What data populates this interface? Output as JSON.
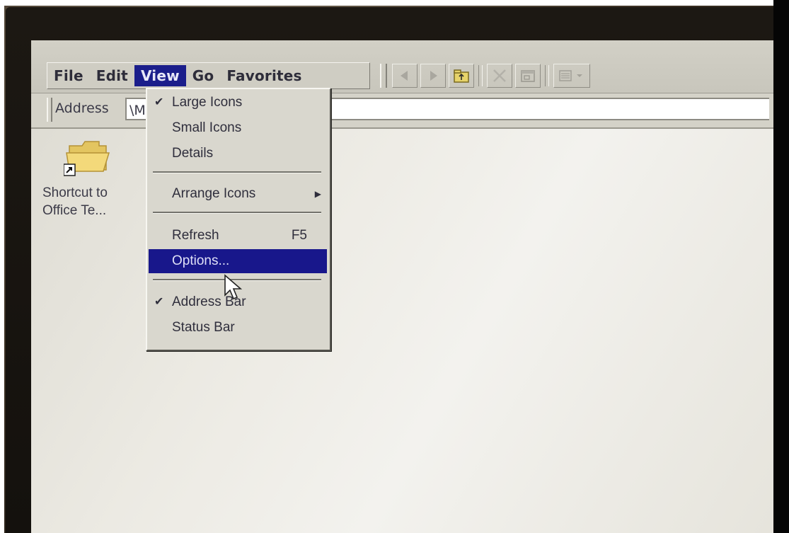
{
  "menubar": {
    "items": [
      {
        "label": "File"
      },
      {
        "label": "Edit"
      },
      {
        "label": "View"
      },
      {
        "label": "Go"
      },
      {
        "label": "Favorites"
      }
    ]
  },
  "toolbar": {
    "icons": [
      "back-icon",
      "forward-icon",
      "up-folder-icon",
      "delete-icon",
      "properties-icon",
      "views-icon"
    ]
  },
  "address": {
    "label": "Address",
    "value": "\\M"
  },
  "desktop": {
    "shortcut": {
      "icon": "folder-shortcut-icon",
      "line1": "Shortcut to",
      "line2": "Office Te..."
    }
  },
  "view_menu": {
    "large_icons": "Large Icons",
    "small_icons": "Small Icons",
    "details": "Details",
    "arrange_icons": "Arrange Icons",
    "refresh": "Refresh",
    "refresh_shortcut": "F5",
    "options": "Options...",
    "address_bar": "Address Bar",
    "status_bar": "Status Bar",
    "checked": [
      "Large Icons",
      "Address Bar"
    ],
    "highlighted": "Options..."
  },
  "colors": {
    "highlight": "#18178b",
    "menu_bg": "#d9d7ce"
  }
}
